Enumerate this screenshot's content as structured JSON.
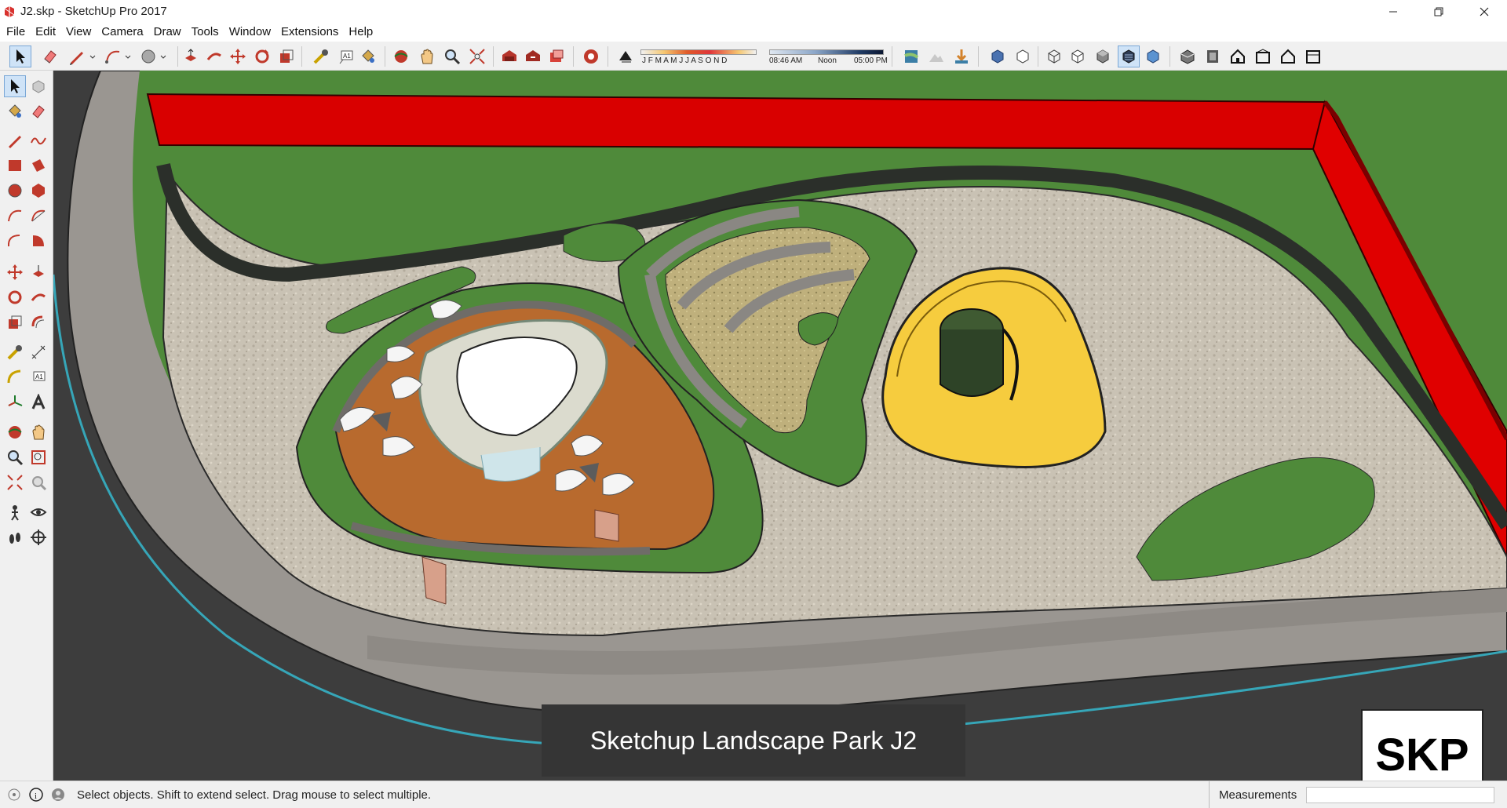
{
  "window": {
    "title": "J2.skp - SketchUp Pro 2017",
    "icons": [
      "sketchup-logo-icon",
      "minimize-icon",
      "restore-icon",
      "close-icon"
    ]
  },
  "menu": {
    "items": [
      "File",
      "Edit",
      "View",
      "Camera",
      "Draw",
      "Tools",
      "Window",
      "Extensions",
      "Help"
    ]
  },
  "toolbar": {
    "months": "J F M A M J J A S O N D",
    "time_start": "08:46 AM",
    "time_noon": "Noon",
    "time_end": "05:00 PM"
  },
  "caption": {
    "text": "Sketchup Landscape Park J2"
  },
  "logo": {
    "text": "SKP"
  },
  "status": {
    "message": "Select objects. Shift to extend select. Drag mouse to select multiple.",
    "measurements_label": "Measurements",
    "measurements_value": ""
  },
  "colors": {
    "wall_red": "#e00000",
    "grass": "#4f8a3a",
    "paving": "#c9c2b4",
    "terracotta": "#b86a2e",
    "yellow": "#f6cc3e",
    "road": "#9a9691"
  }
}
